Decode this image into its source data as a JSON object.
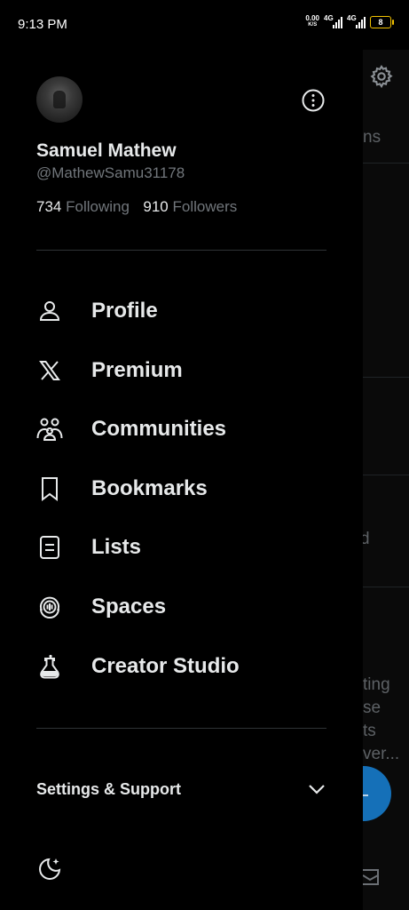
{
  "status_bar": {
    "time": "9:13 PM",
    "net_speed_value": "0.00",
    "net_speed_unit": "K/S",
    "signal1_label": "4G",
    "signal2_label": "4G",
    "battery": "8"
  },
  "profile": {
    "name": "Samuel Mathew",
    "handle": "@MathewSamu31178",
    "following_count": "734",
    "following_label": "Following",
    "followers_count": "910",
    "followers_label": "Followers"
  },
  "menu": [
    {
      "label": "Profile",
      "icon": "person-icon"
    },
    {
      "label": "Premium",
      "icon": "x-logo-icon"
    },
    {
      "label": "Communities",
      "icon": "communities-icon"
    },
    {
      "label": "Bookmarks",
      "icon": "bookmark-icon"
    },
    {
      "label": "Lists",
      "icon": "list-icon"
    },
    {
      "label": "Spaces",
      "icon": "spaces-icon"
    },
    {
      "label": "Creator Studio",
      "icon": "flask-icon"
    }
  ],
  "settings": {
    "label": "Settings & Support",
    "icon": "chevron-down-icon"
  },
  "display_icon": "moon-sparkle-icon",
  "background_page": {
    "fragments": [
      "ns",
      "d",
      "ting",
      "se",
      "ts",
      "ver..."
    ]
  },
  "colors": {
    "background": "#000000",
    "text_primary": "#e7e9ea",
    "text_secondary": "#71767b",
    "divider": "#2f3336",
    "fab_blue": "#1570b8",
    "battery_outline": "#f2c200"
  }
}
